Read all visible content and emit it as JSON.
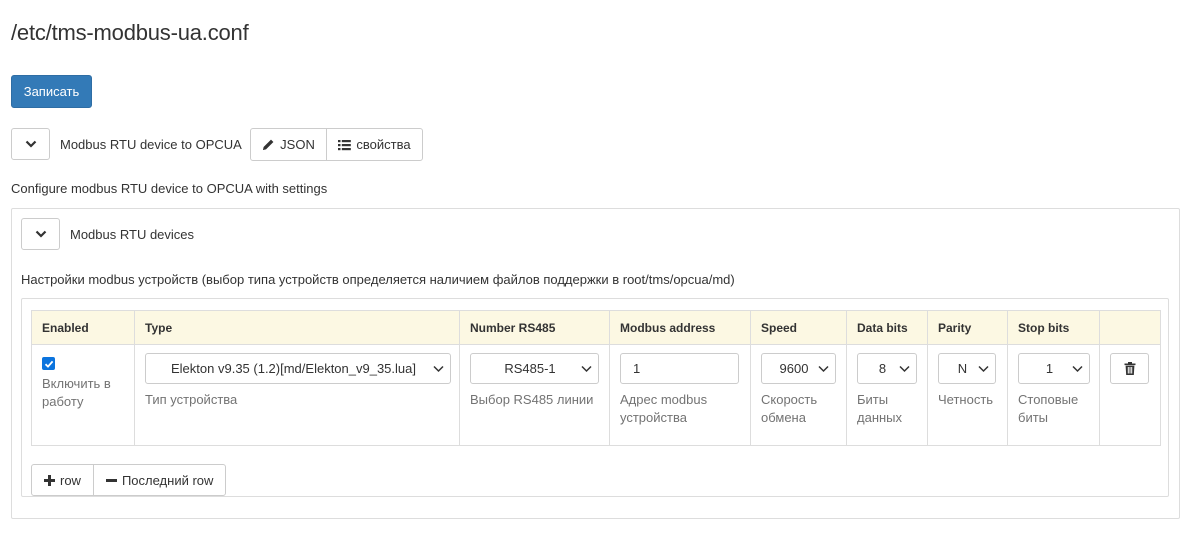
{
  "page": {
    "title": "/etc/tms-modbus-ua.conf"
  },
  "toolbar": {
    "save_label": "Записать"
  },
  "root_section": {
    "title": "Modbus RTU device to OPCUA",
    "json_button": "JSON",
    "properties_button": "свойства",
    "description": "Configure modbus RTU device to OPCUA with settings"
  },
  "devices_section": {
    "title": "Modbus RTU devices",
    "description": "Настройки modbus устройств (выбор типа устройств определяется наличием файлов поддержки в root/tms/opcua/md)"
  },
  "table": {
    "headers": {
      "enabled": "Enabled",
      "type": "Type",
      "rs485": "Number RS485",
      "address": "Modbus address",
      "speed": "Speed",
      "data_bits": "Data bits",
      "parity": "Parity",
      "stop_bits": "Stop bits"
    },
    "row": {
      "enabled_checked": true,
      "enabled_help": "Включить в работу",
      "type_value": "Elekton v9.35 (1.2)[md/Elekton_v9_35.lua]",
      "type_help": "Тип устройства",
      "rs485_value": "RS485-1",
      "rs485_help": "Выбор RS485 линии",
      "address_value": "1",
      "address_help": "Адрес modbus устройства",
      "speed_value": "9600",
      "speed_help": "Скорость обмена",
      "data_bits_value": "8",
      "data_bits_help": "Биты данных",
      "parity_value": "N",
      "parity_help": "Четность",
      "stop_bits_value": "1",
      "stop_bits_help": "Стоповые биты"
    }
  },
  "row_actions": {
    "add_label": "row",
    "remove_label": "Последний row"
  },
  "colors": {
    "primary": "#337ab7",
    "header_bg": "#fcf8e3",
    "checkbox": "#0b74de",
    "help_text": "#737373"
  }
}
